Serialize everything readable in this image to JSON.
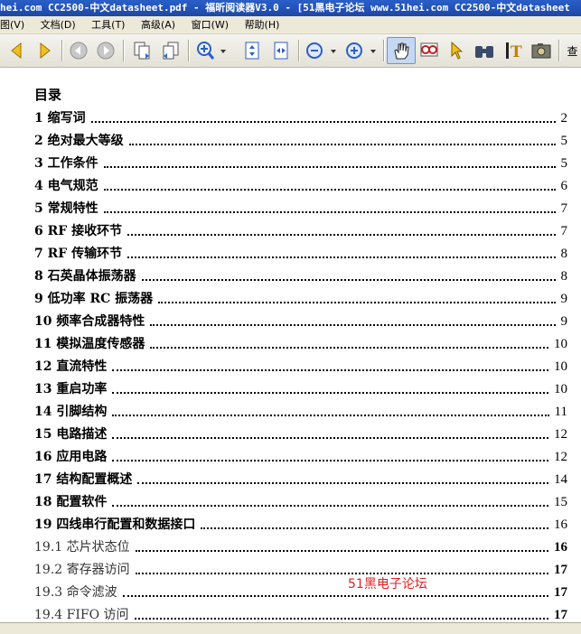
{
  "window": {
    "title": "hei.com CC2500-中文datasheet.pdf - 福昕阅读器V3.0 - [51黑电子论坛 www.51hei.com CC2500-中文datasheet"
  },
  "menu": [
    "图(V)",
    "文档(D)",
    "工具(T)",
    "高级(A)",
    "窗口(W)",
    "帮助(H)"
  ],
  "toolbar": {
    "search_label": "查",
    "icons": [
      "arrow-left",
      "arrow-right",
      "back",
      "forward",
      "copy-page",
      "extract-page",
      "zoom-in",
      "fit-page",
      "fit-width",
      "zoom-out",
      "zoom-in-2",
      "hand",
      "glasses",
      "select-arrow",
      "binoculars",
      "text-tool",
      "snapshot"
    ]
  },
  "toc": {
    "title": "目录",
    "entries": [
      {
        "label": "1  缩写词",
        "page": "2"
      },
      {
        "label": "2  绝对最大等级",
        "page": "5"
      },
      {
        "label": "3  工作条件",
        "page": "5"
      },
      {
        "label": "4  电气规范",
        "page": "6"
      },
      {
        "label": "5  常规特性",
        "page": "7"
      },
      {
        "label": "6 RF 接收环节",
        "page": "7"
      },
      {
        "label": "7 RF 传输环节",
        "page": "8"
      },
      {
        "label": "8  石英晶体振荡器",
        "page": "8"
      },
      {
        "label": "9  低功率 RC 振荡器",
        "page": "9"
      },
      {
        "label": "10  频率合成器特性",
        "page": "9"
      },
      {
        "label": "11  模拟温度传感器",
        "page": "10"
      },
      {
        "label": "12  直流特性",
        "page": "10"
      },
      {
        "label": "13  重启功率",
        "page": "10"
      },
      {
        "label": "14  引脚结构",
        "page": "11"
      },
      {
        "label": "15  电路描述",
        "page": "12"
      },
      {
        "label": "16  应用电路",
        "page": "12"
      },
      {
        "label": "17  结构配置概述",
        "page": "14"
      },
      {
        "label": "18  配置软件",
        "page": "15"
      },
      {
        "label": "19  四线串行配置和数据接口",
        "page": "16"
      },
      {
        "label": "19.1  芯片状态位",
        "page": "16",
        "sub": true
      },
      {
        "label": "19.2  寄存器访问",
        "page": "17",
        "sub": true
      },
      {
        "label": "19.3  命令滤波",
        "page": "17",
        "sub": true
      },
      {
        "label": "19.4 FIFO 访问",
        "page": "17",
        "sub": true
      }
    ]
  },
  "watermark": "51黑电子论坛"
}
